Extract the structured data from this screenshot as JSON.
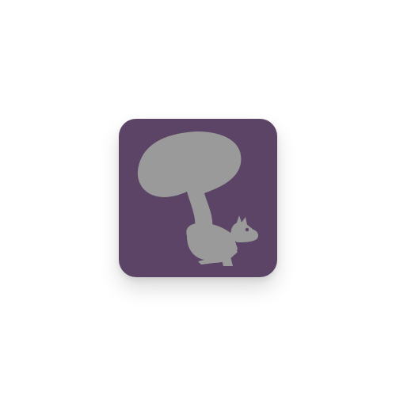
{
  "app_icon": {
    "icon_name": "squirrel-icon",
    "background_color": "#5c4466",
    "glyph_color": "#9a9a9a",
    "eye_color": "#5c4466"
  }
}
